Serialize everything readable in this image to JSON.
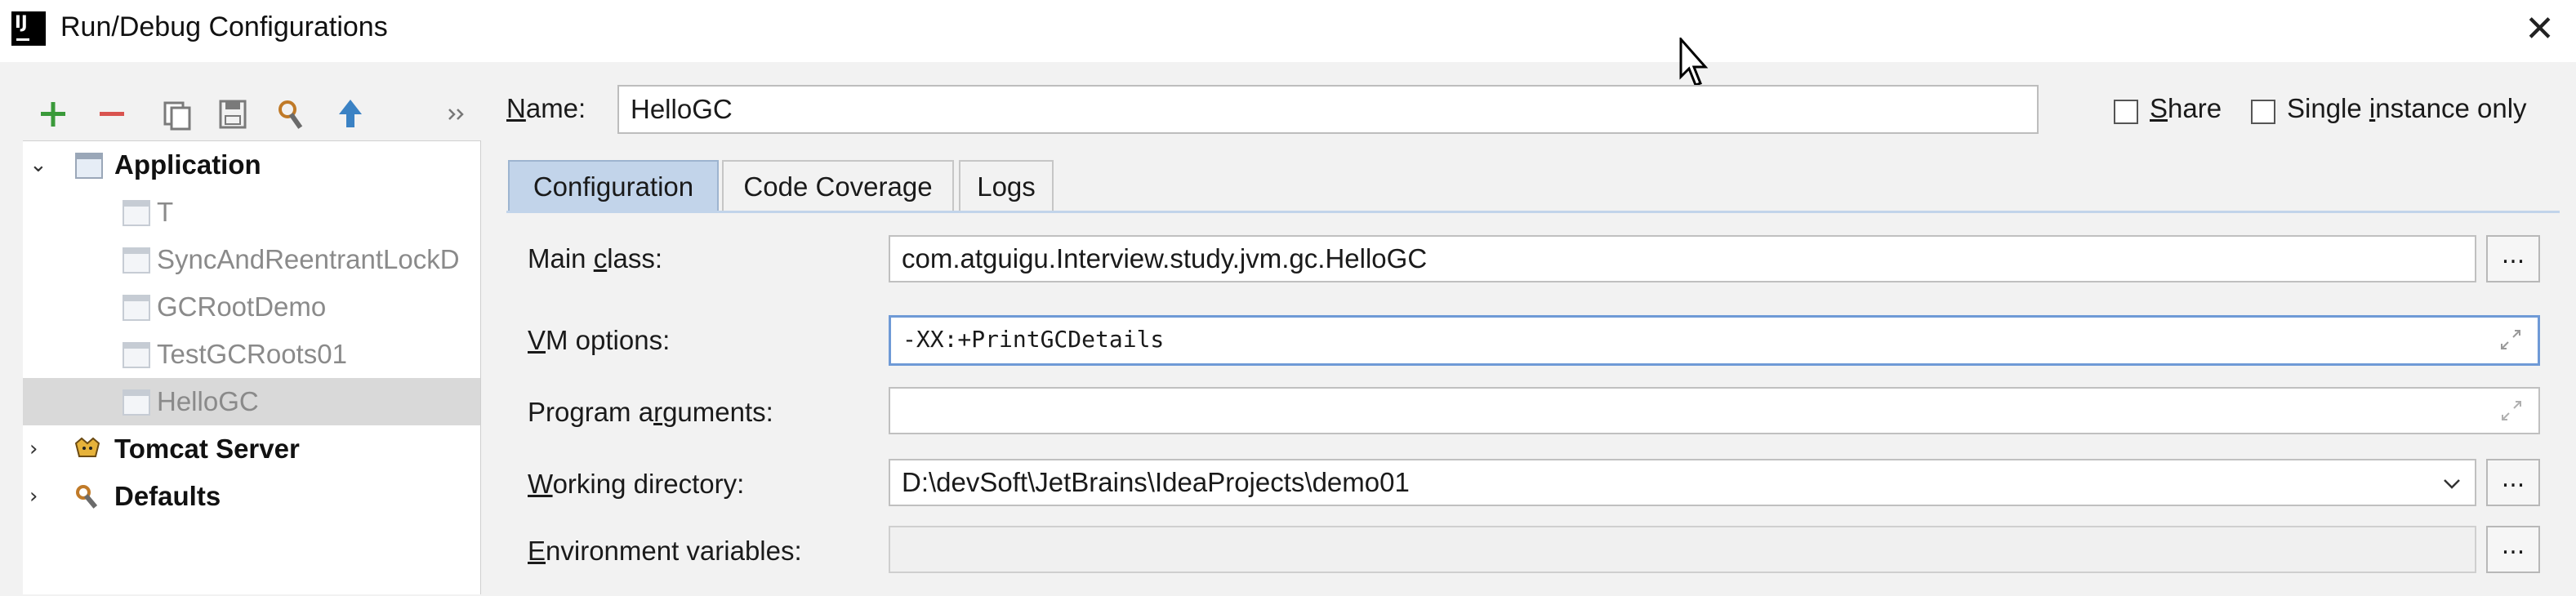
{
  "window": {
    "app_icon": "intellij-logo-icon",
    "app_icon_text": "IJ",
    "title": "Run/Debug Configurations",
    "close_icon": "close-icon"
  },
  "toolbar": {
    "buttons": [
      {
        "icon": "add-icon",
        "color": "#3a9a3a"
      },
      {
        "icon": "remove-icon",
        "color": "#d9534f"
      },
      {
        "icon": "copy-icon"
      },
      {
        "icon": "save-icon"
      },
      {
        "icon": "edit-defaults-icon"
      },
      {
        "icon": "move-up-icon",
        "color": "#3b82c4"
      },
      {
        "icon": "more-icon"
      }
    ]
  },
  "tree": {
    "items": [
      {
        "label": "Application",
        "level": 0,
        "expanded": true,
        "bold": true
      },
      {
        "label": "T",
        "level": 1
      },
      {
        "label": "SyncAndReentrantLockD",
        "level": 1
      },
      {
        "label": "GCRootDemo",
        "level": 1
      },
      {
        "label": "TestGCRoots01",
        "level": 1
      },
      {
        "label": "HelloGC",
        "level": 1,
        "selected": true
      },
      {
        "label": "Tomcat Server",
        "level": 0,
        "expanded": false,
        "bold": true
      },
      {
        "label": "Defaults",
        "level": 0,
        "expanded": false,
        "bold": true
      }
    ]
  },
  "name_field": {
    "label_pre": "",
    "label_u": "N",
    "label_post": "ame:",
    "value": "HelloGC"
  },
  "share": {
    "label_pre": "",
    "label_u": "S",
    "label_post": "hare",
    "checked": false
  },
  "single_instance": {
    "label_pre": "Single ",
    "label_u": "i",
    "label_post": "nstance only",
    "checked": false
  },
  "tabs": [
    {
      "label": "Configuration",
      "active": true
    },
    {
      "label": "Code Coverage",
      "active": false
    },
    {
      "label": "Logs",
      "active": false
    }
  ],
  "form": {
    "main_class": {
      "label_pre": "Main ",
      "label_u": "c",
      "label_post": "lass:",
      "value": "com.atguigu.Interview.study.jvm.gc.HelloGC",
      "browse": "..."
    },
    "vm_options": {
      "label_pre": "",
      "label_u": "V",
      "label_post": "M options:",
      "value": "-XX:+PrintGCDetails"
    },
    "program_arguments": {
      "label_pre": "Program a",
      "label_u": "r",
      "label_post": "guments:",
      "value": ""
    },
    "working_directory": {
      "label_pre": "",
      "label_u": "W",
      "label_post": "orking directory:",
      "value": "D:\\devSoft\\JetBrains\\IdeaProjects\\demo01",
      "browse": "..."
    },
    "environment_variables": {
      "label_pre": "",
      "label_u": "E",
      "label_post": "nvironment variables:",
      "value": "",
      "browse": "..."
    }
  },
  "colors": {
    "accent_tab": "#c2d4ea",
    "focus_border": "#6f9ad6",
    "selection": "#d9d9d9"
  }
}
